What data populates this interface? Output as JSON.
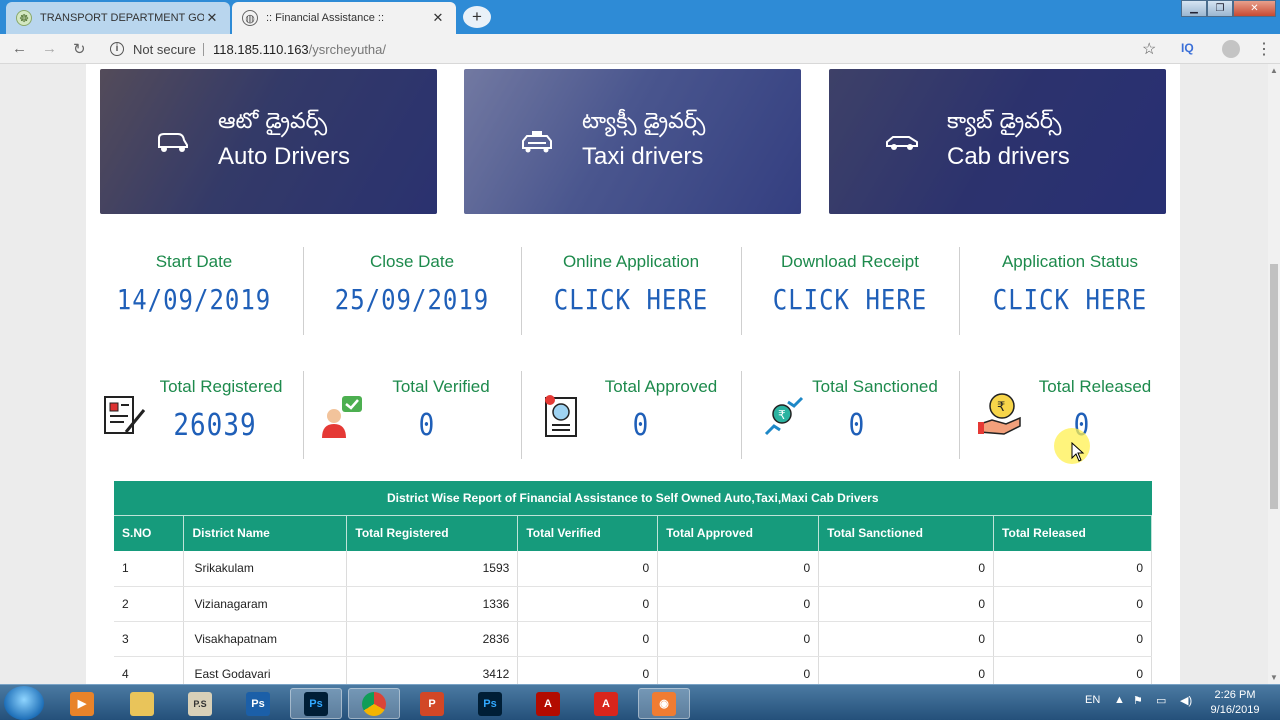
{
  "browser": {
    "tabs": [
      {
        "title": "TRANSPORT DEPARTMENT GOVE"
      },
      {
        "title": ":: Financial Assistance ::"
      }
    ],
    "security_label": "Not secure",
    "url_host": "118.185.110.163",
    "url_path": "/ysrcheyutha/",
    "extension_label": "IQ"
  },
  "banners": [
    {
      "telugu": "ఆటో డ్రైవర్స్",
      "english": "Auto Drivers",
      "icon": "auto-rickshaw-icon"
    },
    {
      "telugu": "ట్యాక్సీ డ్రైవర్స్",
      "english": "Taxi drivers",
      "icon": "taxi-icon"
    },
    {
      "telugu": "క్యాబ్ డ్రైవర్స్",
      "english": "Cab drivers",
      "icon": "car-icon"
    }
  ],
  "info": [
    {
      "label": "Start Date",
      "value": "14/09/2019"
    },
    {
      "label": "Close Date",
      "value": "25/09/2019"
    },
    {
      "label": "Online Application",
      "value": "CLICK HERE"
    },
    {
      "label": "Download Receipt",
      "value": "CLICK HERE"
    },
    {
      "label": "Application Status",
      "value": "CLICK HERE"
    }
  ],
  "stats": [
    {
      "label": "Total Registered",
      "value": "26039",
      "icon": "registration-form-icon"
    },
    {
      "label": "Total Verified",
      "value": "0",
      "icon": "verified-user-icon"
    },
    {
      "label": "Total Approved",
      "value": "0",
      "icon": "approved-document-icon"
    },
    {
      "label": "Total Sanctioned",
      "value": "0",
      "icon": "rupee-exchange-icon"
    },
    {
      "label": "Total Released",
      "value": "0",
      "icon": "rupee-hand-icon"
    }
  ],
  "table": {
    "caption": "District Wise Report of Financial Assistance to Self Owned Auto,Taxi,Maxi Cab Drivers",
    "headers": [
      "S.NO",
      "District Name",
      "Total Registered",
      "Total Verified",
      "Total Approved",
      "Total Sanctioned",
      "Total Released"
    ],
    "rows": [
      [
        "1",
        "Srikakulam",
        "1593",
        "0",
        "0",
        "0",
        "0"
      ],
      [
        "2",
        "Vizianagaram",
        "1336",
        "0",
        "0",
        "0",
        "0"
      ],
      [
        "3",
        "Visakhapatnam",
        "2836",
        "0",
        "0",
        "0",
        "0"
      ],
      [
        "4",
        "East Godavari",
        "3412",
        "0",
        "0",
        "0",
        "0"
      ]
    ]
  },
  "taskbar": {
    "apps": [
      "media-player",
      "file-explorer",
      "ps-70",
      "photoshop",
      "photoshop",
      "chrome",
      "powerpoint",
      "photoshop",
      "acrobat",
      "acrobat",
      "screen-recorder"
    ],
    "language": "EN",
    "time": "2:26 PM",
    "date": "9/16/2019"
  },
  "colors": {
    "accent_green": "#1d8a4c",
    "table_header": "#169b7c",
    "digital_blue": "#1f5fb8"
  }
}
